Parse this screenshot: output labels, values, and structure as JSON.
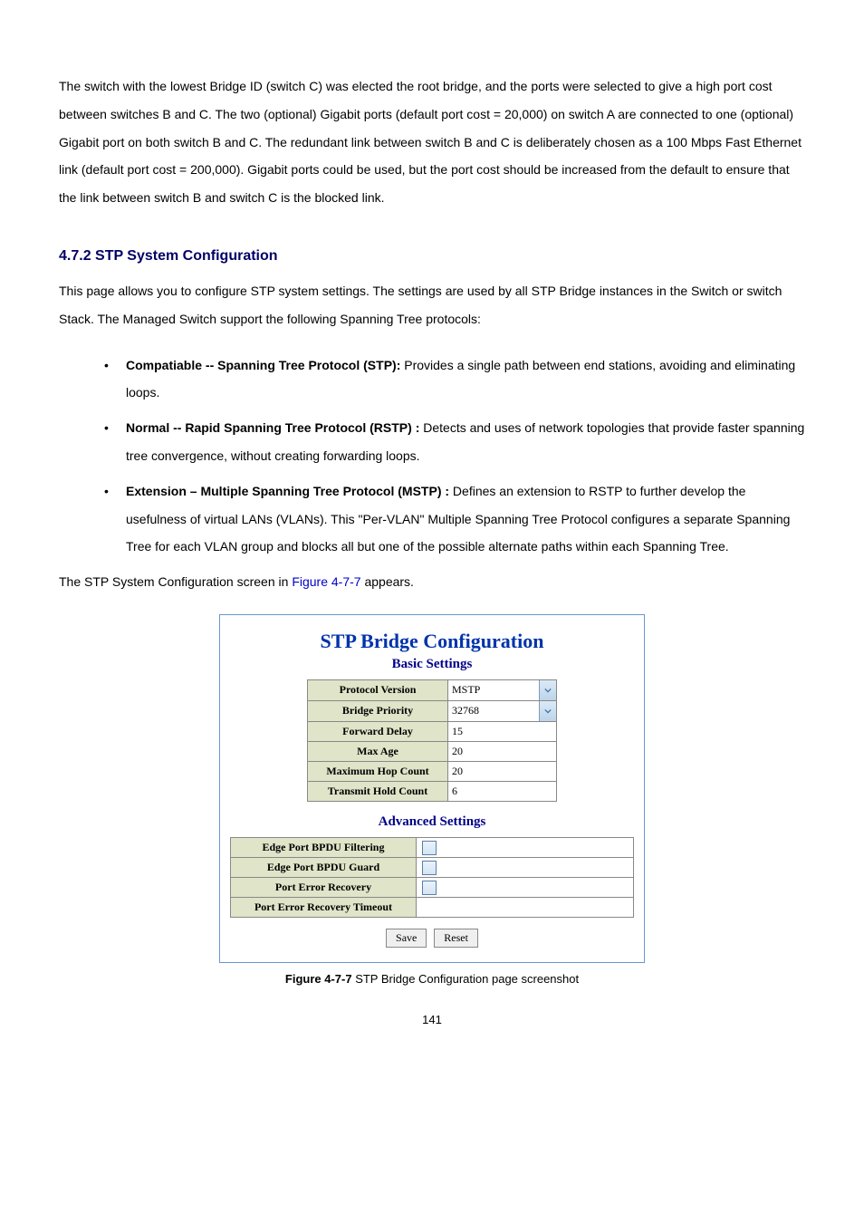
{
  "paragraph1": "The switch with the lowest Bridge ID (switch C) was elected the root bridge, and the ports were selected to give a high port cost between switches B and C. The two (optional) Gigabit ports (default port cost = 20,000) on switch A are connected to one (optional) Gigabit port on both switch B and C. The redundant link between switch B and C is deliberately chosen as a 100 Mbps Fast Ethernet link (default port cost = 200,000). Gigabit ports could be used, but the port cost should be increased from the default to ensure that the link between switch B and switch C is the blocked link.",
  "section_heading": "4.7.2 STP System Configuration",
  "paragraph2": "This page allows you to configure STP system settings. The settings are used by all STP Bridge instances in the Switch or switch Stack. The Managed Switch support the following Spanning Tree protocols:",
  "bullet1": {
    "lead": "Compatiable -- Spanning Tree Protocol (STP):",
    "body": "Provides a single path between end stations, avoiding and eliminating loops."
  },
  "bullet2": {
    "lead": "Normal -- Rapid Spanning Tree Protocol (RSTP) :",
    "body": "Detects and uses of network topologies that provide faster spanning tree convergence, without creating forwarding loops."
  },
  "bullet3": {
    "lead": "Extension – Multiple Spanning Tree Protocol (MSTP) :",
    "body": "Defines an extension to RSTP to further develop the usefulness of virtual LANs (VLANs). This \"Per-VLAN\" Multiple Spanning Tree Protocol configures a separate Spanning Tree for each VLAN group and blocks all but one of the possible alternate paths within each Spanning Tree."
  },
  "paragraph3_pre": "The STP System Configuration screen in ",
  "paragraph3_link": "Figure 4-7-7",
  "paragraph3_post": " appears.",
  "panel": {
    "title": "STP Bridge Configuration",
    "basic_title": "Basic Settings",
    "advanced_title": "Advanced Settings",
    "rows_basic": {
      "protocol_version": {
        "label": "Protocol Version",
        "value": "MSTP"
      },
      "bridge_priority": {
        "label": "Bridge Priority",
        "value": "32768"
      },
      "forward_delay": {
        "label": "Forward Delay",
        "value": "15"
      },
      "max_age": {
        "label": "Max Age",
        "value": "20"
      },
      "max_hop": {
        "label": "Maximum Hop Count",
        "value": "20"
      },
      "tx_hold": {
        "label": "Transmit Hold Count",
        "value": "6"
      }
    },
    "rows_adv": {
      "edge_filter": {
        "label": "Edge Port BPDU Filtering"
      },
      "edge_guard": {
        "label": "Edge Port BPDU Guard"
      },
      "err_recovery": {
        "label": "Port Error Recovery"
      },
      "err_timeout": {
        "label": "Port Error Recovery Timeout",
        "value": ""
      }
    },
    "buttons": {
      "save": "Save",
      "reset": "Reset"
    }
  },
  "caption_lead": "Figure 4-7-7",
  "caption_body": " STP Bridge Configuration page screenshot",
  "page_number": "141"
}
